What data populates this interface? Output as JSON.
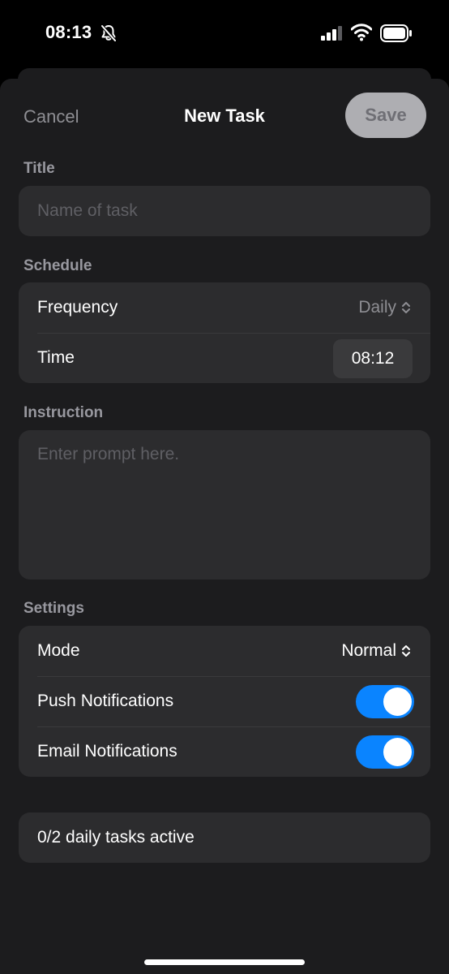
{
  "status_bar": {
    "time": "08:13",
    "icons": [
      "bell-slash-icon",
      "cellular-signal-icon",
      "wifi-icon",
      "battery-icon"
    ]
  },
  "nav": {
    "cancel_label": "Cancel",
    "title": "New Task",
    "save_label": "Save"
  },
  "title_section": {
    "label": "Title",
    "placeholder": "Name of task"
  },
  "schedule": {
    "label": "Schedule",
    "frequency_label": "Frequency",
    "frequency_value": "Daily",
    "time_label": "Time",
    "time_value": "08:12"
  },
  "instruction": {
    "label": "Instruction",
    "placeholder": "Enter prompt here."
  },
  "settings": {
    "label": "Settings",
    "mode_label": "Mode",
    "mode_value": "Normal",
    "push_label": "Push Notifications",
    "push_enabled": true,
    "email_label": "Email Notifications",
    "email_enabled": true
  },
  "footer": {
    "status_text": "0/2 daily tasks active"
  },
  "colors": {
    "accent": "#0a84ff",
    "background": "#1c1c1e",
    "card": "#2c2c2e"
  }
}
